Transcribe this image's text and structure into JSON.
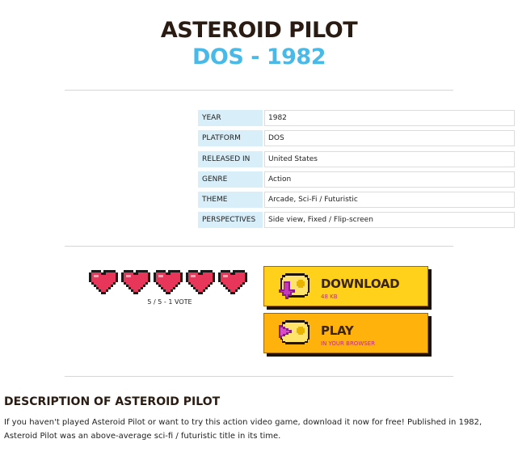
{
  "header": {
    "title": "ASTEROID PILOT",
    "subtitle": "DOS - 1982"
  },
  "info": {
    "rows": [
      {
        "key": "YEAR",
        "value": "1982"
      },
      {
        "key": "PLATFORM",
        "value": "DOS"
      },
      {
        "key": "RELEASED IN",
        "value": "United States"
      },
      {
        "key": "GENRE",
        "value": "Action"
      },
      {
        "key": "THEME",
        "value": "Arcade, Sci-Fi / Futuristic"
      },
      {
        "key": "PERSPECTIVES",
        "value": "Side view, Fixed / Flip-screen"
      }
    ]
  },
  "rating": {
    "stars": 5,
    "max": 5,
    "text": "5 / 5 - 1 VOTE",
    "heart_color": "#e8365a"
  },
  "buttons": {
    "download": {
      "label": "DOWNLOAD",
      "sub": "48 KB",
      "color": "#ffd11a"
    },
    "play": {
      "label": "PLAY",
      "sub": "IN YOUR BROWSER",
      "color": "#ffb10c"
    }
  },
  "description": {
    "heading": "DESCRIPTION OF ASTEROID PILOT",
    "text": "If you haven't played Asteroid Pilot or want to try this action video game, download it now for free! Published in 1982, Asteroid Pilot was an above-average sci-fi / futuristic title in its time."
  }
}
